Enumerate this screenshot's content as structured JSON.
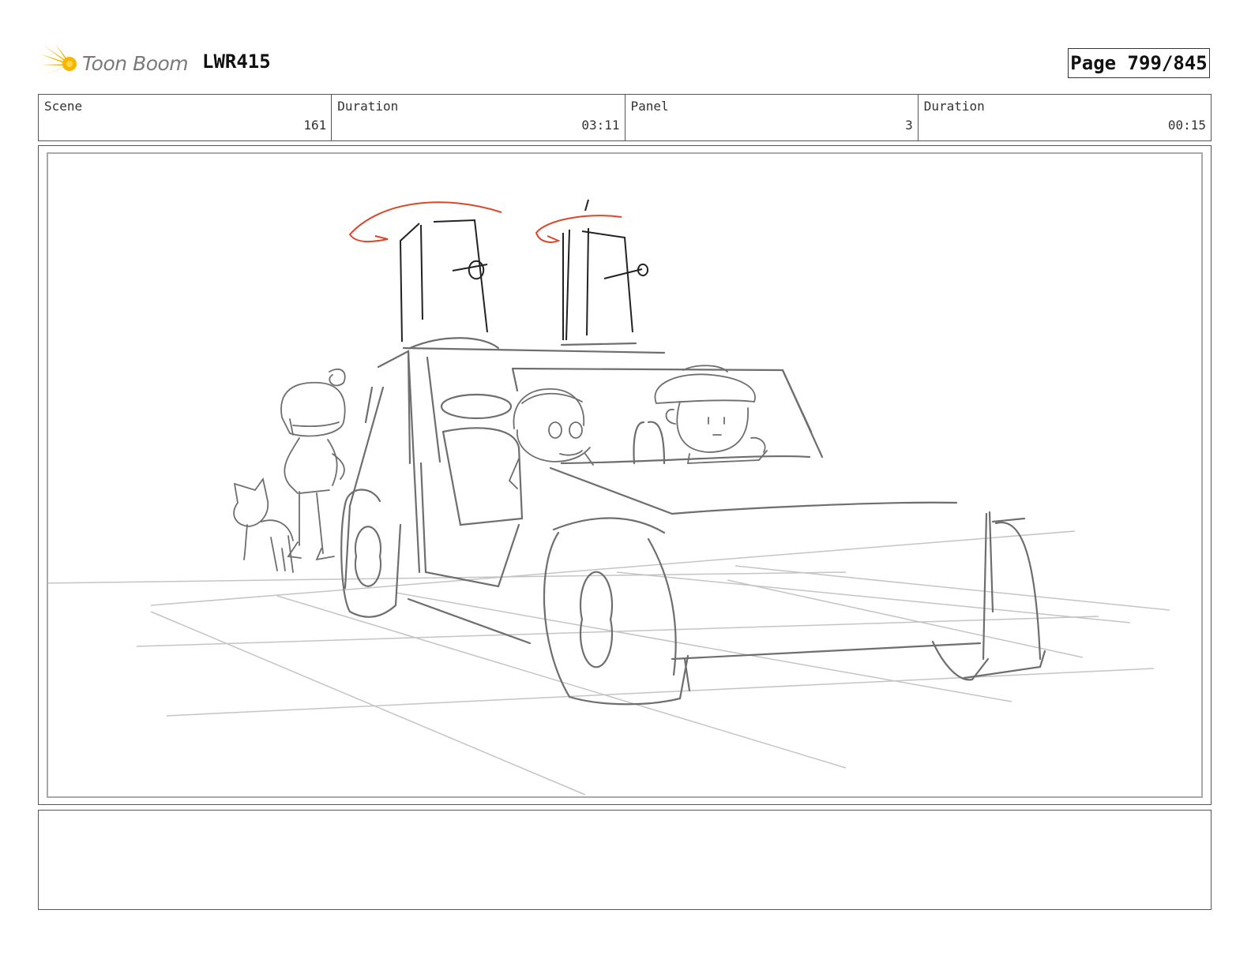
{
  "header": {
    "logo_text": "Toon Boom",
    "project_code": "LWR415",
    "page_indicator": "Page 799/845"
  },
  "info": {
    "scene_label": "Scene",
    "scene_value": "161",
    "scene_duration_label": "Duration",
    "scene_duration_value": "03:11",
    "panel_label": "Panel",
    "panel_value": "3",
    "panel_duration_label": "Duration",
    "panel_duration_value": "00:15"
  },
  "notes": {
    "text": ""
  },
  "colors": {
    "logo_yellow": "#f7b500",
    "sketch_gray": "#6e6e6e",
    "guide_gray": "#c4c4c4",
    "action_red": "#d9482b"
  }
}
